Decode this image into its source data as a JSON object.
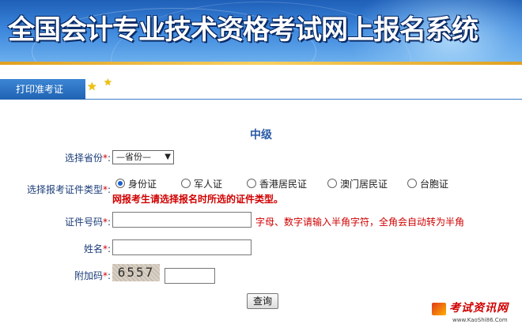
{
  "header": {
    "title": "全国会计专业技术资格考试网上报名系统"
  },
  "tab": {
    "label": "打印准考证"
  },
  "form": {
    "level": "中级",
    "province_label": "选择省份",
    "province_value": "—省份—",
    "cert_type_label": "选择报考证件类型",
    "cert_options": [
      {
        "label": "身份证",
        "selected": true
      },
      {
        "label": "军人证",
        "selected": false
      },
      {
        "label": "香港居民证",
        "selected": false
      },
      {
        "label": "澳门居民证",
        "selected": false
      },
      {
        "label": "台胞证",
        "selected": false
      }
    ],
    "cert_warning": "网报考生请选择报名时所选的证件类型。",
    "id_label": "证件号码",
    "id_value": "",
    "id_hint": "字母、数字请输入半角字符，全角会自动转为半角",
    "name_label": "姓名",
    "name_value": "",
    "captcha_label": "附加码",
    "captcha_text": "6557",
    "captcha_value": "",
    "submit_label": "查询",
    "required_mark": "*",
    "colon": ":"
  },
  "watermark": {
    "name": "考试资讯网",
    "url": "www.KaoShi86.Com"
  }
}
